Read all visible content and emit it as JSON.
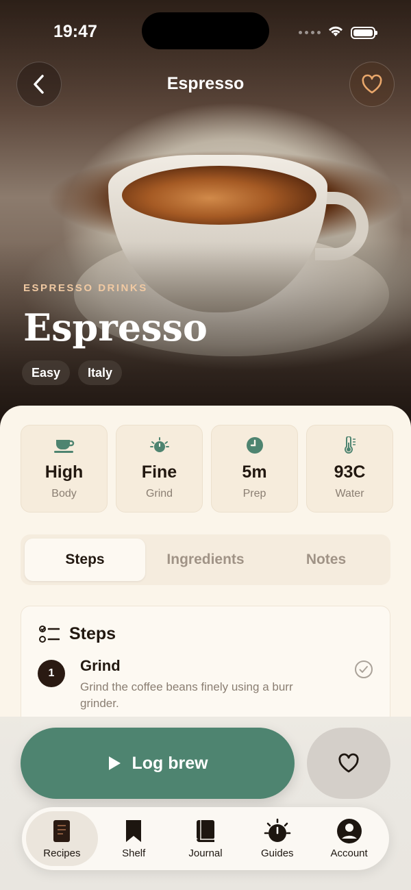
{
  "status": {
    "time": "19:47"
  },
  "nav": {
    "title": "Espresso"
  },
  "hero": {
    "category": "ESPRESSO DRINKS",
    "title": "Espresso",
    "tags": [
      "Easy",
      "Italy"
    ]
  },
  "stats": [
    {
      "value": "High",
      "label": "Body",
      "icon": "cup-icon"
    },
    {
      "value": "Fine",
      "label": "Grind",
      "icon": "grinder-icon"
    },
    {
      "value": "5m",
      "label": "Prep",
      "icon": "clock-icon"
    },
    {
      "value": "93C",
      "label": "Water",
      "icon": "thermometer-icon"
    }
  ],
  "tabs": [
    "Steps",
    "Ingredients",
    "Notes"
  ],
  "steps_card": {
    "title": "Steps",
    "steps": [
      {
        "number": "1",
        "title": "Grind",
        "description": "Grind the coffee beans finely using a burr grinder."
      }
    ]
  },
  "actions": {
    "log_brew": "Log brew"
  },
  "tabbar": [
    {
      "label": "Recipes",
      "icon": "recipes-icon"
    },
    {
      "label": "Shelf",
      "icon": "bookmark-icon"
    },
    {
      "label": "Journal",
      "icon": "book-icon"
    },
    {
      "label": "Guides",
      "icon": "guides-icon"
    },
    {
      "label": "Account",
      "icon": "account-icon"
    }
  ],
  "colors": {
    "accent": "#4e8470",
    "category": "#f0c9a2",
    "sheet": "#fbf5ea"
  }
}
